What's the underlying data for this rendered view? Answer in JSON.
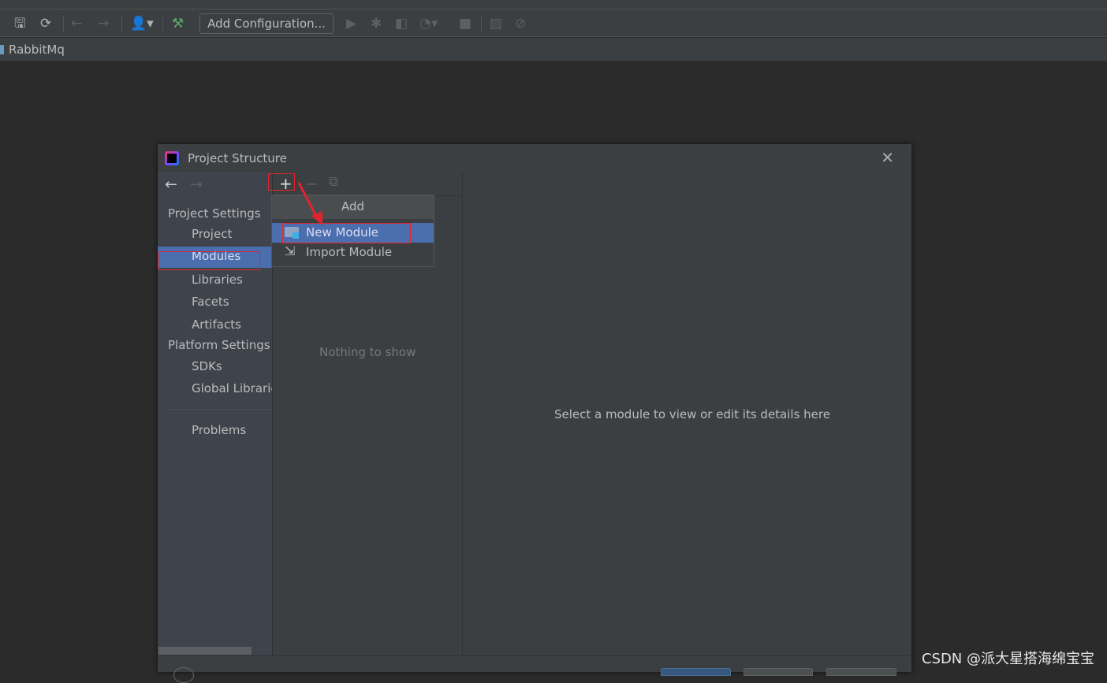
{
  "toolbar": {
    "add_configuration": "Add Configuration..."
  },
  "navbar": {
    "project": "RabbitMq"
  },
  "dialog": {
    "title": "Project Structure",
    "sidebar": {
      "project_settings_header": "Project Settings",
      "project_items": [
        "Project",
        "Modules",
        "Libraries",
        "Facets",
        "Artifacts"
      ],
      "platform_settings_header": "Platform Settings",
      "platform_items": [
        "SDKs",
        "Global Libraries"
      ],
      "problems": "Problems",
      "selected": "Modules"
    },
    "modules_panel": {
      "empty_text": "Nothing to show"
    },
    "add_popup": {
      "title": "Add",
      "items": [
        "New Module",
        "Import Module"
      ],
      "selected": "New Module"
    },
    "details": {
      "placeholder": "Select a module to view or edit its details here"
    }
  },
  "watermark": "CSDN @派大星搭海绵宝宝",
  "colors": {
    "selection": "#4b6eaf",
    "annotation": "#e0242b"
  }
}
